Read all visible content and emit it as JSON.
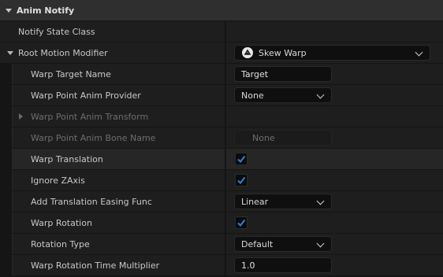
{
  "category": {
    "title": "Anim Notify"
  },
  "rows": {
    "notify_state_class": {
      "label": "Notify State Class"
    },
    "root_motion_modifier": {
      "label": "Root Motion Modifier",
      "value": "Skew Warp",
      "icon": "skew-warp-icon"
    },
    "warp_target_name": {
      "label": "Warp Target Name",
      "value": "Target"
    },
    "warp_point_anim_provider": {
      "label": "Warp Point Anim Provider",
      "value": "None"
    },
    "warp_point_anim_transform": {
      "label": "Warp Point Anim Transform"
    },
    "warp_point_anim_bone_name": {
      "label": "Warp Point Anim Bone Name",
      "placeholder": "None"
    },
    "warp_translation": {
      "label": "Warp Translation",
      "checked": true
    },
    "ignore_zaxis": {
      "label": "Ignore ZAxis",
      "checked": true
    },
    "add_translation_easing_func": {
      "label": "Add Translation Easing Func",
      "value": "Linear"
    },
    "warp_rotation": {
      "label": "Warp Rotation",
      "checked": true
    },
    "rotation_type": {
      "label": "Rotation Type",
      "value": "Default"
    },
    "warp_rotation_time_multiplier": {
      "label": "Warp Rotation Time Multiplier",
      "value": "1.0"
    }
  },
  "colors": {
    "checkmark": "#2f7fe0",
    "background": "#151515",
    "row": "#1e1e1e",
    "category": "#2f2f2f"
  }
}
